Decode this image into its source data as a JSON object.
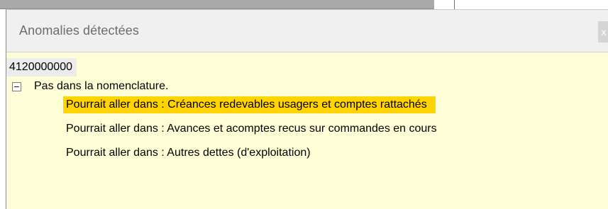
{
  "window": {
    "title": "Anomalies détectées",
    "close_label": "x"
  },
  "tree": {
    "account": "4120000000",
    "node": {
      "expanded": true,
      "label": "Pas dans la nomenclature.",
      "children": [
        {
          "label": "Pourrait aller dans : Créances redevables usagers et comptes rattachés",
          "selected": true
        },
        {
          "label": "Pourrait aller dans : Avances et acomptes recus sur commandes en cours",
          "selected": false
        },
        {
          "label": "Pourrait aller dans : Autres dettes (d'exploitation)",
          "selected": false
        }
      ]
    }
  },
  "colors": {
    "panel_background": "#ffffd7",
    "selection_highlight": "#ffd400",
    "title_text": "#6d6d6d"
  }
}
